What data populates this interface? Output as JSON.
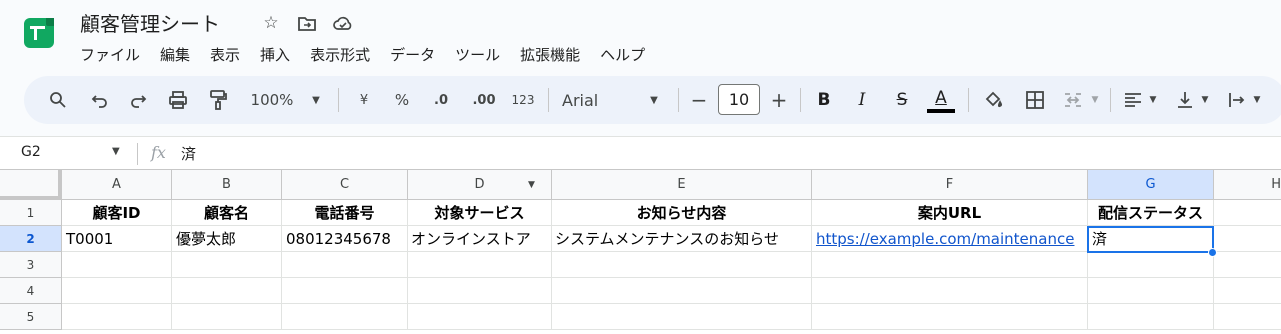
{
  "doc": {
    "title": "顧客管理シート"
  },
  "menu": [
    "ファイル",
    "編集",
    "表示",
    "挿入",
    "表示形式",
    "データ",
    "ツール",
    "拡張機能",
    "ヘルプ"
  ],
  "toolbar": {
    "zoom": "100%",
    "currency": "¥",
    "percent": "%",
    "dec_decrease": ".0",
    "dec_increase": ".00",
    "number_format": "123",
    "font": "Arial",
    "font_size": "10",
    "minus": "−",
    "plus": "+",
    "bold": "B",
    "italic": "I",
    "strike": "S",
    "text_color": "A"
  },
  "formula_bar": {
    "cell_ref": "G2",
    "fx": "fx",
    "value": "済"
  },
  "grid": {
    "columns": [
      "A",
      "B",
      "C",
      "D",
      "E",
      "F",
      "G",
      "H"
    ],
    "selected_column": "G",
    "rows": [
      "1",
      "2",
      "3",
      "4",
      "5"
    ],
    "selected_row": "2",
    "header_row": [
      "顧客ID",
      "顧客名",
      "電話番号",
      "対象サービス",
      "お知らせ内容",
      "案内URL",
      "配信ステータス"
    ],
    "data_rows": [
      [
        "T0001",
        "優夢太郎",
        "08012345678",
        "オンラインストア",
        "システムメンテナンスのお知らせ",
        "https://example.com/maintenance",
        "済"
      ]
    ]
  },
  "colors": {
    "accent": "#1a73e8",
    "link": "#1155cc",
    "logo": "#11a861",
    "selected_header": "#d3e3fd"
  }
}
